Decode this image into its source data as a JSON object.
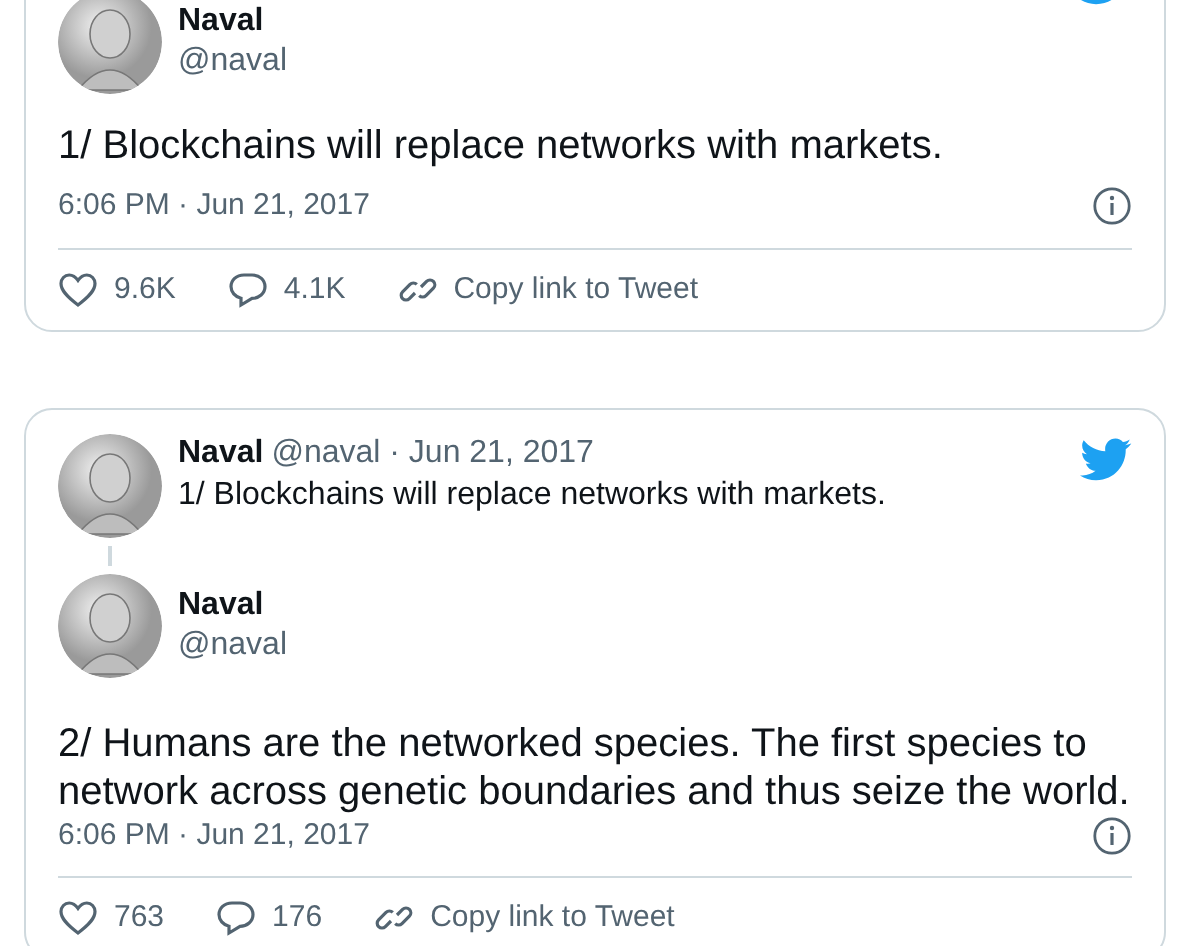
{
  "tweets": [
    {
      "author": {
        "name": "Naval",
        "handle": "@naval"
      },
      "text": "1/ Blockchains will replace networks with markets.",
      "time": "6:06 PM · Jun 21, 2017",
      "actions": {
        "likes": "9.6K",
        "replies": "4.1K",
        "copy_link": "Copy link to Tweet"
      }
    },
    {
      "parent": {
        "name": "Naval",
        "meta": "@naval · Jun 21, 2017",
        "text": "1/ Blockchains will replace networks with markets."
      },
      "author": {
        "name": "Naval",
        "handle": "@naval"
      },
      "text": "2/ Humans are the networked species. The first species to network across genetic boundaries and thus seize the world.",
      "time": "6:06 PM · Jun 21, 2017",
      "actions": {
        "likes": "763",
        "replies": "176",
        "copy_link": "Copy link to Tweet"
      }
    }
  ]
}
